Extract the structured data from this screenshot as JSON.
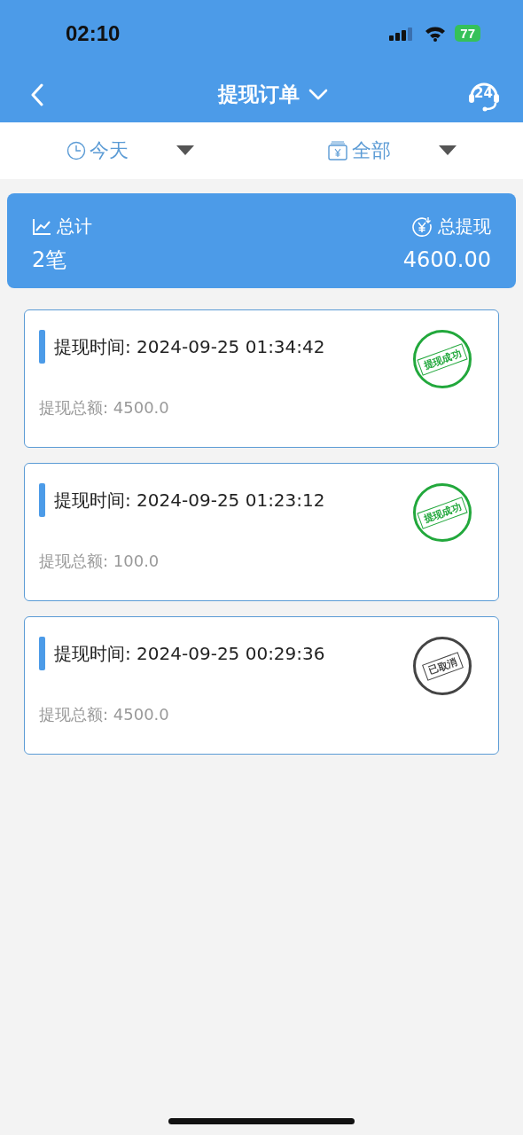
{
  "status_bar": {
    "time": "02:10",
    "battery": "77"
  },
  "nav": {
    "title": "提现订单",
    "support_badge": "24"
  },
  "filters": [
    {
      "kind": "date",
      "label": "今天"
    },
    {
      "kind": "type",
      "label": "全部"
    }
  ],
  "summary": {
    "count_label": "总计",
    "count": "2笔",
    "total_label": "总提现",
    "total": "4600.00"
  },
  "orders": [
    {
      "time_label": "提现时间:",
      "time": "2024-09-25 01:34:42",
      "amount_label": "提现总额:",
      "amount": "4500.0",
      "stamp": {
        "kind": "success",
        "text": "提现成功"
      }
    },
    {
      "time_label": "提现时间:",
      "time": "2024-09-25 01:23:12",
      "amount_label": "提现总额:",
      "amount": "100.0",
      "stamp": {
        "kind": "success",
        "text": "提现成功"
      }
    },
    {
      "time_label": "提现时间:",
      "time": "2024-09-25 00:29:36",
      "amount_label": "提现总额:",
      "amount": "4500.0",
      "stamp": {
        "kind": "cancelled",
        "text": "已取消"
      }
    }
  ]
}
